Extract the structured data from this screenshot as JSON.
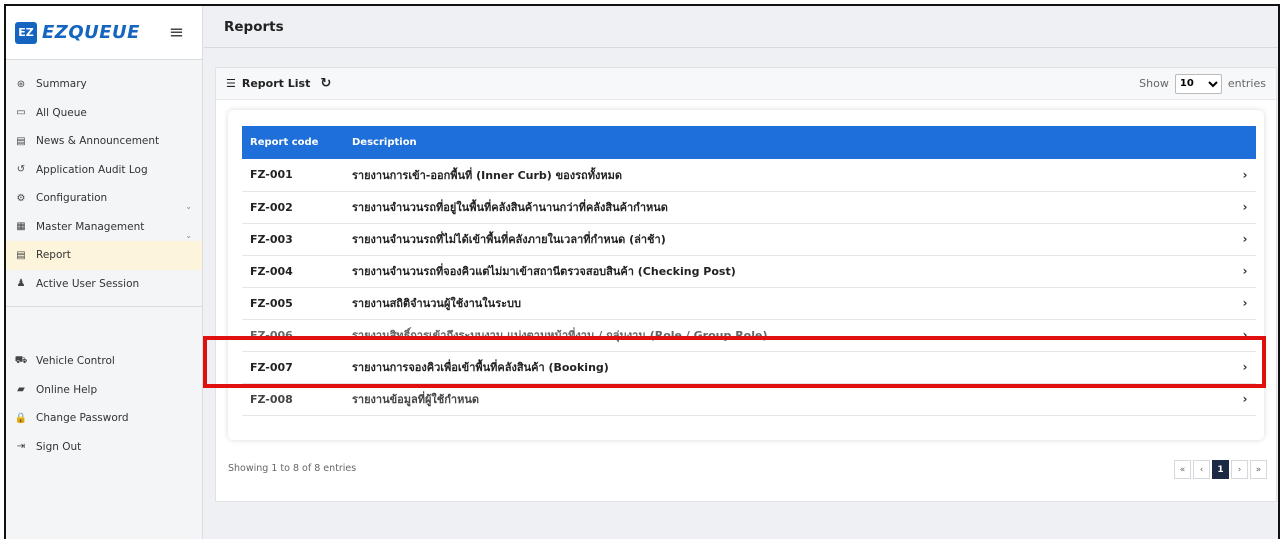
{
  "brand": {
    "logo_text": "EZ",
    "name": "EZQUEUE",
    "menu_icon": "hamburger-icon"
  },
  "sidebar": {
    "items": [
      {
        "label": "Summary",
        "icon": "dashboard-icon",
        "glyph": "⊛"
      },
      {
        "label": "All Queue",
        "icon": "queue-icon",
        "glyph": "▭"
      },
      {
        "label": "News & Announcement",
        "icon": "news-icon",
        "glyph": "▤"
      },
      {
        "label": "Application Audit Log",
        "icon": "history-icon",
        "glyph": "↺"
      },
      {
        "label": "Configuration",
        "icon": "gears-icon",
        "glyph": "⚙"
      },
      {
        "label": "Master Management",
        "icon": "table-icon",
        "glyph": "▦"
      },
      {
        "label": "Report",
        "icon": "file-icon",
        "glyph": "▤"
      },
      {
        "label": "Active User Session",
        "icon": "user-icon",
        "glyph": "♟"
      }
    ],
    "items2": [
      {
        "label": "Vehicle Control",
        "icon": "truck-icon",
        "glyph": "⛟"
      },
      {
        "label": "Online Help",
        "icon": "book-icon",
        "glyph": "▰"
      },
      {
        "label": "Change Password",
        "icon": "lock-icon",
        "glyph": "🔒"
      },
      {
        "label": "Sign Out",
        "icon": "sign-out-icon",
        "glyph": "⇥"
      }
    ],
    "active": "Report"
  },
  "header": {
    "title": "Reports"
  },
  "panel": {
    "title": "Report List",
    "show_label": "Show",
    "entries_value": "10",
    "entries_label": "entries",
    "columns": [
      "Report code",
      "Description"
    ],
    "rows": [
      {
        "code": "FZ-001",
        "desc": "รายงานการเข้า-ออกพื้นที่ (Inner Curb) ของรถทั้งหมด"
      },
      {
        "code": "FZ-002",
        "desc": "รายงานจำนวนรถที่อยู่ในพื้นที่คลังสินค้านานกว่าที่คลังสินค้ากำหนด"
      },
      {
        "code": "FZ-003",
        "desc": "รายงานจำนวนรถที่ไม่ได้เข้าพื้นที่คลังภายในเวลาที่กำหนด (ล่าช้า)"
      },
      {
        "code": "FZ-004",
        "desc": "รายงานจำนวนรถที่จองคิวแต่ไม่มาเข้าสถานีตรวจสอบสินค้า (Checking Post)"
      },
      {
        "code": "FZ-005",
        "desc": "รายงานสถิติจำนวนผู้ใช้งานในระบบ"
      },
      {
        "code": "FZ-006",
        "desc": "รายงานสิทธิ์การเข้าถึงระบบงาน แบ่งตามหน้าที่งาน / กลุ่มงาน (Role / Group Role)"
      },
      {
        "code": "FZ-007",
        "desc": "รายงานการจองคิวเพื่อเข้าพื้นที่คลังสินค้า (Booking)"
      },
      {
        "code": "FZ-008",
        "desc": "รายงานข้อมูลที่ผู้ใช้กำหนด"
      }
    ],
    "footer_info": "Showing 1 to 8 of 8 entries",
    "pager": {
      "first": "«",
      "prev": "‹",
      "current": "1",
      "next": "›",
      "last": "»"
    }
  },
  "colors": {
    "accent": "#1e6fd9",
    "highlight": "#e01010",
    "active_bg": "#fdf5db"
  }
}
